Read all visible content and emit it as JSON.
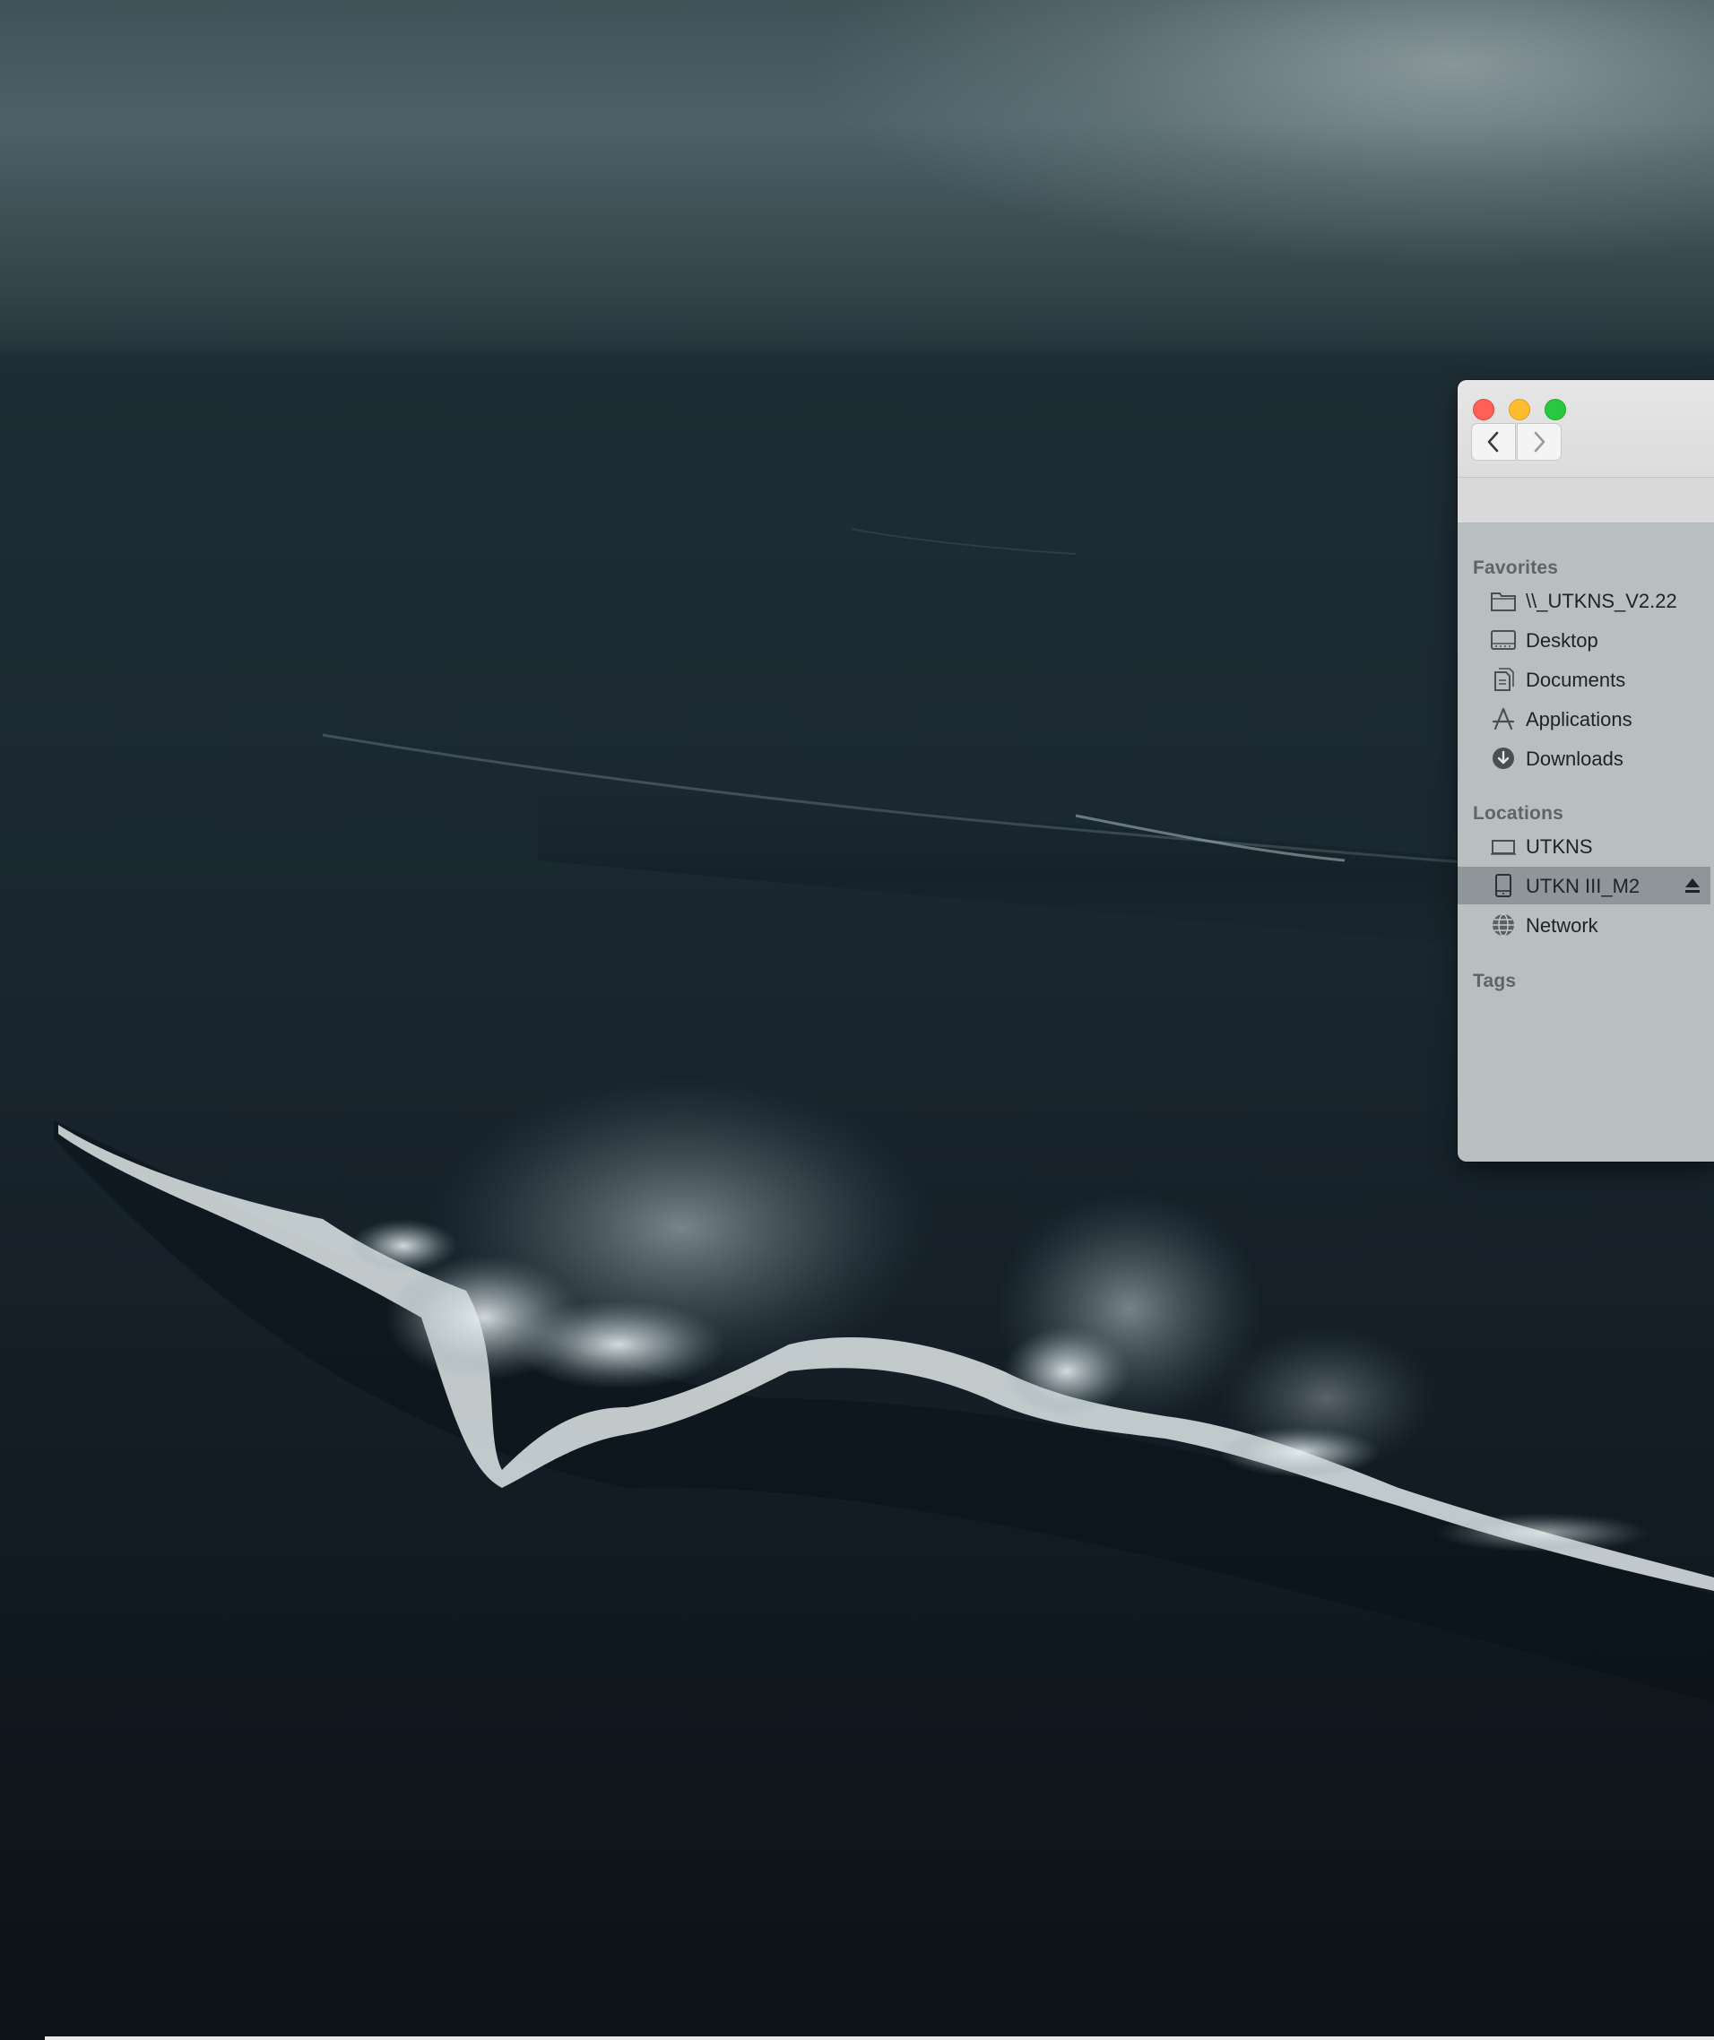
{
  "finder": {
    "sidebar": {
      "favorites_header": "Favorites",
      "favorites": [
        {
          "label": "\\\\_UTKNS_V2.22",
          "icon": "folder-icon"
        },
        {
          "label": "Desktop",
          "icon": "desktop-icon"
        },
        {
          "label": "Documents",
          "icon": "documents-icon"
        },
        {
          "label": "Applications",
          "icon": "applications-icon"
        },
        {
          "label": "Downloads",
          "icon": "downloads-icon"
        }
      ],
      "locations_header": "Locations",
      "locations": [
        {
          "label": "UTKNS",
          "icon": "laptop-icon"
        },
        {
          "label": "UTKN III_M2",
          "icon": "external-drive-icon",
          "selected": true,
          "ejectable": true
        },
        {
          "label": "Network",
          "icon": "network-globe-icon"
        }
      ],
      "tags_header": "Tags"
    },
    "window_controls": [
      "close",
      "minimize",
      "zoom"
    ],
    "navigation": [
      "back",
      "forward"
    ]
  },
  "colors": {
    "close": "#fe5f57",
    "minimize": "#febc2e",
    "zoom": "#28c840",
    "sidebar_bg": "#b9bec1",
    "selected_row": "#8f969a"
  }
}
